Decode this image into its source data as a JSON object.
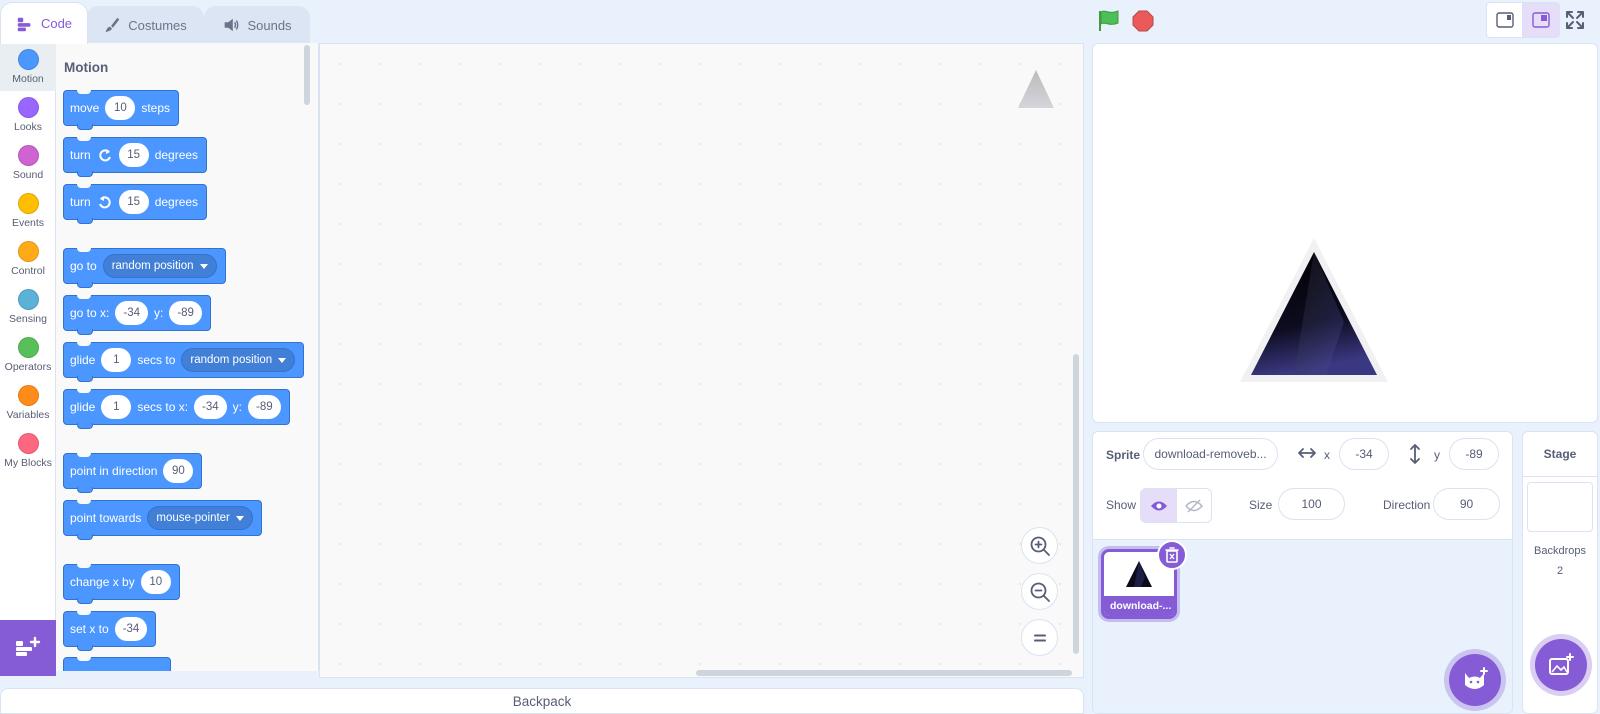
{
  "tabs": [
    {
      "label": "Code",
      "icon": "code-icon",
      "active": true
    },
    {
      "label": "Costumes",
      "icon": "brush-icon",
      "active": false
    },
    {
      "label": "Sounds",
      "icon": "speaker-icon",
      "active": false
    }
  ],
  "controls": {
    "go": "green-flag-icon",
    "stop": "stop-sign-icon"
  },
  "categories": [
    {
      "label": "Motion",
      "color": "#4c97ff",
      "selected": true
    },
    {
      "label": "Looks",
      "color": "#9966ff"
    },
    {
      "label": "Sound",
      "color": "#cf63cf"
    },
    {
      "label": "Events",
      "color": "#ffbf00"
    },
    {
      "label": "Control",
      "color": "#ffab19"
    },
    {
      "label": "Sensing",
      "color": "#5cb1d6"
    },
    {
      "label": "Operators",
      "color": "#59c059"
    },
    {
      "label": "Variables",
      "color": "#ff8c1a"
    },
    {
      "label": "My Blocks",
      "color": "#ff6680"
    }
  ],
  "palette": {
    "title": "Motion",
    "move": {
      "pre": "move",
      "value": "10",
      "post": "steps"
    },
    "turn_right": {
      "pre": "turn",
      "value": "15",
      "post": "degrees"
    },
    "turn_left": {
      "pre": "turn",
      "value": "15",
      "post": "degrees"
    },
    "go_to": {
      "pre": "go to",
      "option": "random position"
    },
    "go_to_xy": {
      "pre": "go to x:",
      "x": "-34",
      "mid": "y:",
      "y": "-89"
    },
    "glide_to": {
      "pre": "glide",
      "value": "1",
      "mid": "secs to",
      "option": "random position"
    },
    "glide_xy": {
      "pre": "glide",
      "value": "1",
      "mid": "secs to x:",
      "x": "-34",
      "mid2": "y:",
      "y": "-89"
    },
    "point_dir": {
      "pre": "point in direction",
      "value": "90"
    },
    "point_towards": {
      "pre": "point towards",
      "option": "mouse-pointer"
    },
    "change_x": {
      "pre": "change x by",
      "value": "10"
    },
    "set_x": {
      "pre": "set x to",
      "value": "-34"
    }
  },
  "backpack": {
    "label": "Backpack"
  },
  "sprite_info": {
    "sprite_label": "Sprite",
    "sprite_name": "download-removeb...",
    "x_label": "x",
    "x_value": "-34",
    "y_label": "y",
    "y_value": "-89",
    "show_label": "Show",
    "size_label": "Size",
    "size_value": "100",
    "direction_label": "Direction",
    "direction_value": "90"
  },
  "sprites": [
    {
      "name": "download-...",
      "selected": true
    }
  ],
  "stage_selector": {
    "title": "Stage",
    "backdrops_label": "Backdrops",
    "backdrops_count": "2"
  },
  "colors": {
    "accent": "#855cd6",
    "motion": "#4c97ff",
    "motion_border": "#3373cc",
    "background": "#e9f1fc"
  }
}
